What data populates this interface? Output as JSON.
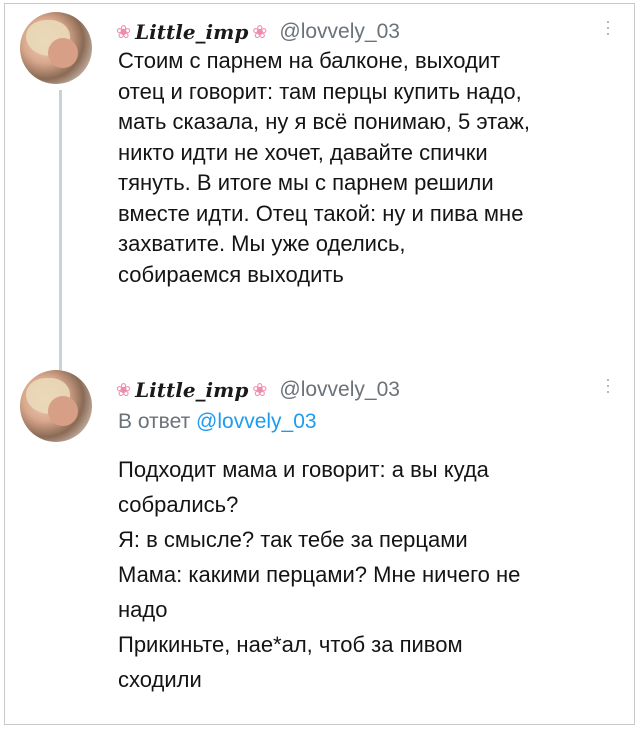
{
  "tweets": [
    {
      "display_name": "Little_imp",
      "handle": "@lovvely_03",
      "text": "Стоим с парнем на балконе, выходит\nотец и говорит: там перцы купить надо,\nмать сказала, ну я всё понимаю, 5 этаж,\nникто идти не хочет, давайте спички\nтянуть. В итоге мы с парнем решили\nвместе идти. Отец такой: ну и пива мне\nзахватите. Мы уже оделись,\nсобираемся выходить"
    },
    {
      "display_name": "Little_imp",
      "handle": "@lovvely_03",
      "reply_prefix": "В ответ",
      "reply_handle": "@lovvely_03",
      "text": "Подходит мама и говорит: а вы куда\nсобрались?\nЯ: в смысле? так тебе за перцами\nМама: какими перцами? Мне ничего не\nнадо\nПрикиньте, нае*ал, чтоб за пивом\nсходили"
    }
  ],
  "icons": {
    "flower": "flower-icon",
    "more": "more-options-icon"
  },
  "colors": {
    "handle": "#6b7278",
    "link": "#1d9bf0",
    "flower": "#f08bb0",
    "thread_line": "#c9d2d8"
  }
}
